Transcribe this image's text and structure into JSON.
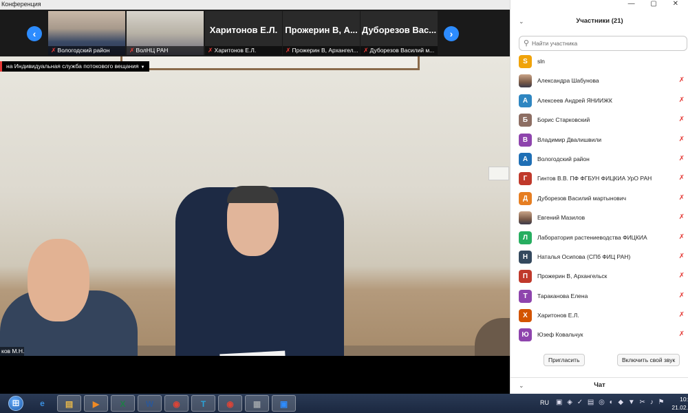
{
  "window": {
    "title": "Конференция"
  },
  "video_strip": {
    "tiles": [
      {
        "label": "Вологодский район",
        "big": ""
      },
      {
        "label": "ВолНЦ РАН",
        "big": ""
      },
      {
        "label": "Харитонов Е.Л.",
        "big": "Харитонов Е.Л."
      },
      {
        "label": "Прожерин В, Архангел...",
        "big": "Прожерин В, А..."
      },
      {
        "label": "Дуборезов Василий м...",
        "big": "Дуборезов Вас..."
      }
    ],
    "prev_icon": "chevron-left-icon",
    "next_icon": "chevron-right-icon"
  },
  "stream_banner": {
    "label": "на Индивидуальная служба потокового вещания"
  },
  "main_video": {
    "name_label": "ков М.Н."
  },
  "participants": {
    "title": "Участники (21)",
    "search_placeholder": "Найти участника",
    "list": [
      {
        "initial": "S",
        "name": "sln",
        "color": "#f0a30a",
        "muted": false,
        "photo": false
      },
      {
        "initial": "",
        "name": "Александра Шабунова",
        "color": "#c0392b",
        "muted": true,
        "photo": true
      },
      {
        "initial": "А",
        "name": "Алексеев Андрей ЯНИИЖК",
        "color": "#2e86c1",
        "muted": true,
        "photo": false
      },
      {
        "initial": "Б",
        "name": "Борис Старковский",
        "color": "#8d6e63",
        "muted": true,
        "photo": false
      },
      {
        "initial": "В",
        "name": "Владимир Двалишвили",
        "color": "#8e44ad",
        "muted": true,
        "photo": false
      },
      {
        "initial": "А",
        "name": "Вологодский район",
        "color": "#1f6fb5",
        "muted": true,
        "photo": false
      },
      {
        "initial": "Г",
        "name": "Гинтов В.В.  ПФ ФГБУН ФИЦКИА УрО РАН",
        "color": "#c0392b",
        "muted": true,
        "photo": false
      },
      {
        "initial": "Д",
        "name": "Дуборезов Василий мартынович",
        "color": "#e67e22",
        "muted": true,
        "photo": false
      },
      {
        "initial": "",
        "name": "Евгений Мазилов",
        "color": "#888888",
        "muted": true,
        "photo": true
      },
      {
        "initial": "Л",
        "name": "Лаборатория растениеводства ФИЦКИА",
        "color": "#27ae60",
        "muted": true,
        "photo": false
      },
      {
        "initial": "Н",
        "name": "Наталья Осипова (СПб ФИЦ РАН)",
        "color": "#34495e",
        "muted": true,
        "photo": false
      },
      {
        "initial": "П",
        "name": "Прожерин В, Архангельск",
        "color": "#c0392b",
        "muted": true,
        "photo": false
      },
      {
        "initial": "Т",
        "name": "Тараканова Елена",
        "color": "#8e44ad",
        "muted": true,
        "photo": false
      },
      {
        "initial": "Х",
        "name": "Харитонов Е.Л.",
        "color": "#d35400",
        "muted": true,
        "photo": false
      },
      {
        "initial": "Ю",
        "name": "Юзеф Ковальчук",
        "color": "#8e44ad",
        "muted": true,
        "photo": false
      }
    ],
    "invite_label": "Пригласить",
    "unmute_label": "Включить свой звук",
    "chat_title": "Чат"
  },
  "taskbar": {
    "apps": [
      {
        "icon": "internet-explorer-icon",
        "glyph": "e",
        "color": "#3b8fe0"
      },
      {
        "icon": "file-explorer-icon",
        "glyph": "▤",
        "color": "#e8b84a"
      },
      {
        "icon": "media-player-icon",
        "glyph": "▶",
        "color": "#f08a24"
      },
      {
        "icon": "excel-icon",
        "glyph": "X",
        "color": "#1e7e45"
      },
      {
        "icon": "word-icon",
        "glyph": "W",
        "color": "#2b5797"
      },
      {
        "icon": "chrome-icon",
        "glyph": "◉",
        "color": "#db4437"
      },
      {
        "icon": "telegram-icon",
        "glyph": "T",
        "color": "#2aa3d8"
      },
      {
        "icon": "chrome-icon",
        "glyph": "◉",
        "color": "#db4437"
      },
      {
        "icon": "archive-icon",
        "glyph": "▦",
        "color": "#9aa0a6"
      },
      {
        "icon": "zoom-icon",
        "glyph": "▣",
        "color": "#2d8cff"
      }
    ],
    "language": "RU",
    "time": "10:",
    "date": "21.02."
  }
}
